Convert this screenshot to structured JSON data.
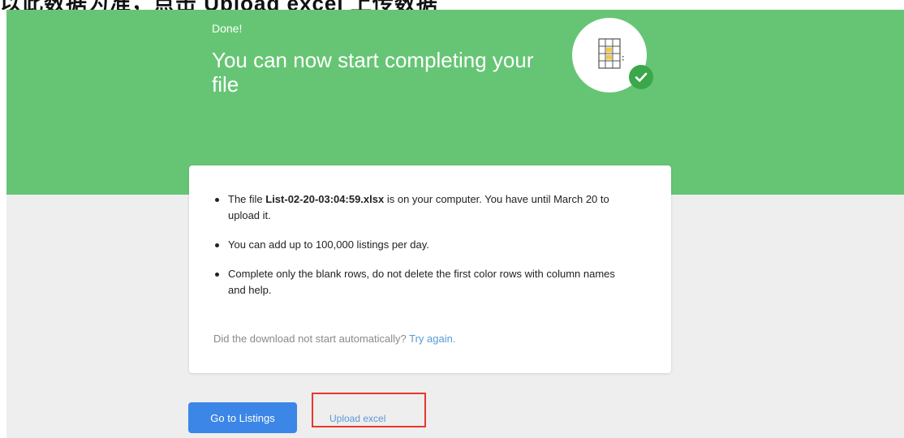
{
  "caption": {
    "text": "以此数据为准，点击 Upload excel 上传数据"
  },
  "hero": {
    "status": "Done!",
    "headline": "You can now start completing your file",
    "background_color": "#66c574",
    "badge_icon": "spreadsheet-icon",
    "badge_check_icon": "check-icon",
    "check_color": "#3ba74b"
  },
  "card": {
    "bullet1": {
      "prefix": "The file ",
      "filename": "List-02-20-03:04:59.xlsx",
      "suffix": " is on your computer. You have until March 20 to upload it."
    },
    "bullet2": "You can add up to 100,000 listings per day.",
    "bullet3": "Complete only the blank rows, do not delete the first color rows with column names and help.",
    "retry_text": "Did the download not start automatically?",
    "retry_link": "Try again."
  },
  "actions": {
    "primary_label": "Go to Listings",
    "primary_color": "#3b86e6",
    "upload_label": "Upload excel",
    "highlight_color": "#e8372c"
  }
}
